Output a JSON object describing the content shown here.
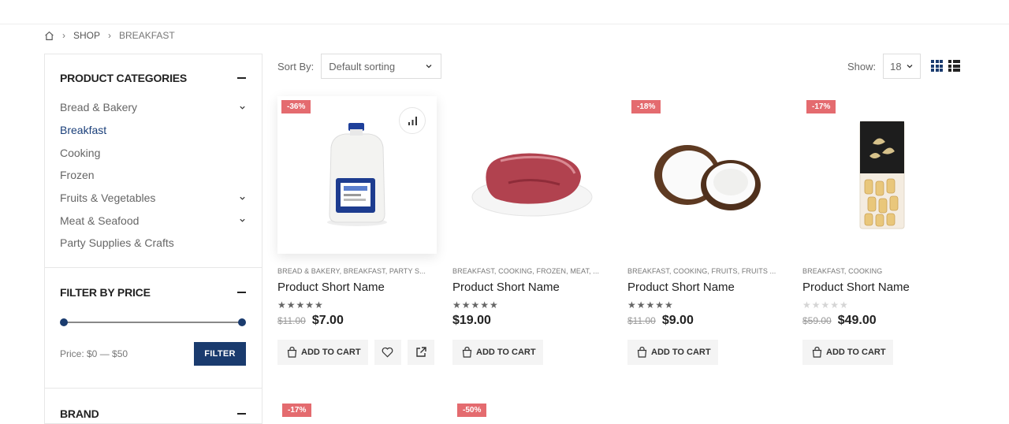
{
  "breadcrumb": {
    "shop": "SHOP",
    "current": "BREAKFAST"
  },
  "sidebar": {
    "categories_title": "PRODUCT CATEGORIES",
    "categories": [
      {
        "label": "Bread & Bakery",
        "expandable": true
      },
      {
        "label": "Breakfast",
        "expandable": false,
        "active": true
      },
      {
        "label": "Cooking",
        "expandable": false
      },
      {
        "label": "Frozen",
        "expandable": false
      },
      {
        "label": "Fruits & Vegetables",
        "expandable": true
      },
      {
        "label": "Meat & Seafood",
        "expandable": true
      },
      {
        "label": "Party Supplies & Crafts",
        "expandable": false
      }
    ],
    "price_title": "FILTER BY PRICE",
    "price_label": "Price: $0 — $50",
    "price_range": {
      "min": 0,
      "max": 50
    },
    "filter_button": "FILTER",
    "brand_title": "BRAND"
  },
  "toolbar": {
    "sort_label": "Sort By:",
    "sort_value": "Default sorting",
    "show_label": "Show:",
    "show_value": "18"
  },
  "colors": {
    "brand": "#1a3b6e",
    "sale_badge": "#e46b6f"
  },
  "products": [
    {
      "badge": "-36%",
      "cats": "BREAD & BAKERY, BREAKFAST, PARTY S...",
      "name": "Product Short Name",
      "rating": 5,
      "old_price": "$11.00",
      "price": "$7.00",
      "cart": "ADD TO CART",
      "image": "milk-jug"
    },
    {
      "badge": "",
      "cats": "BREAKFAST, COOKING, FROZEN, MEAT, ...",
      "name": "Product Short Name",
      "rating": 5,
      "old_price": "",
      "price": "$19.00",
      "cart": "ADD TO CART",
      "image": "raw-beef"
    },
    {
      "badge": "-18%",
      "cats": "BREAKFAST, COOKING, FRUITS, FRUITS ...",
      "name": "Product Short Name",
      "rating": 5,
      "old_price": "$11.00",
      "price": "$9.00",
      "cart": "ADD TO CART",
      "image": "coconut"
    },
    {
      "badge": "-17%",
      "cats": "BREAKFAST, COOKING",
      "name": "Product Short Name",
      "rating": 0,
      "old_price": "$59.00",
      "price": "$49.00",
      "cart": "ADD TO CART",
      "image": "pasta-bag"
    }
  ],
  "row2_badges": [
    "-17%",
    "-50%"
  ]
}
